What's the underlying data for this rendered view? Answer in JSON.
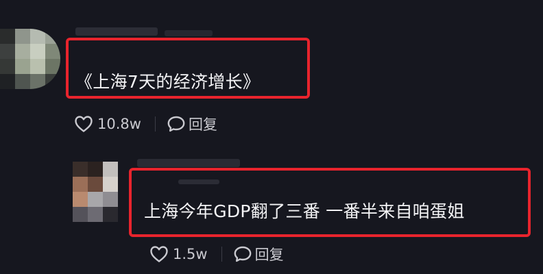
{
  "comments": [
    {
      "text": "《上海7天的经济增长》",
      "likes": "10.8w",
      "reply_label": "回复"
    },
    {
      "text": "上海今年GDP翻了三番 一番半来自咱蛋姐",
      "likes": "1.5w",
      "reply_label": "回复"
    }
  ],
  "colors": {
    "background": "#16171f",
    "highlight": "#e8242d",
    "text": "#f4f4f6",
    "secondary_text": "#c9c9cf"
  },
  "icons": [
    "heart-icon",
    "comment-bubble-icon"
  ]
}
